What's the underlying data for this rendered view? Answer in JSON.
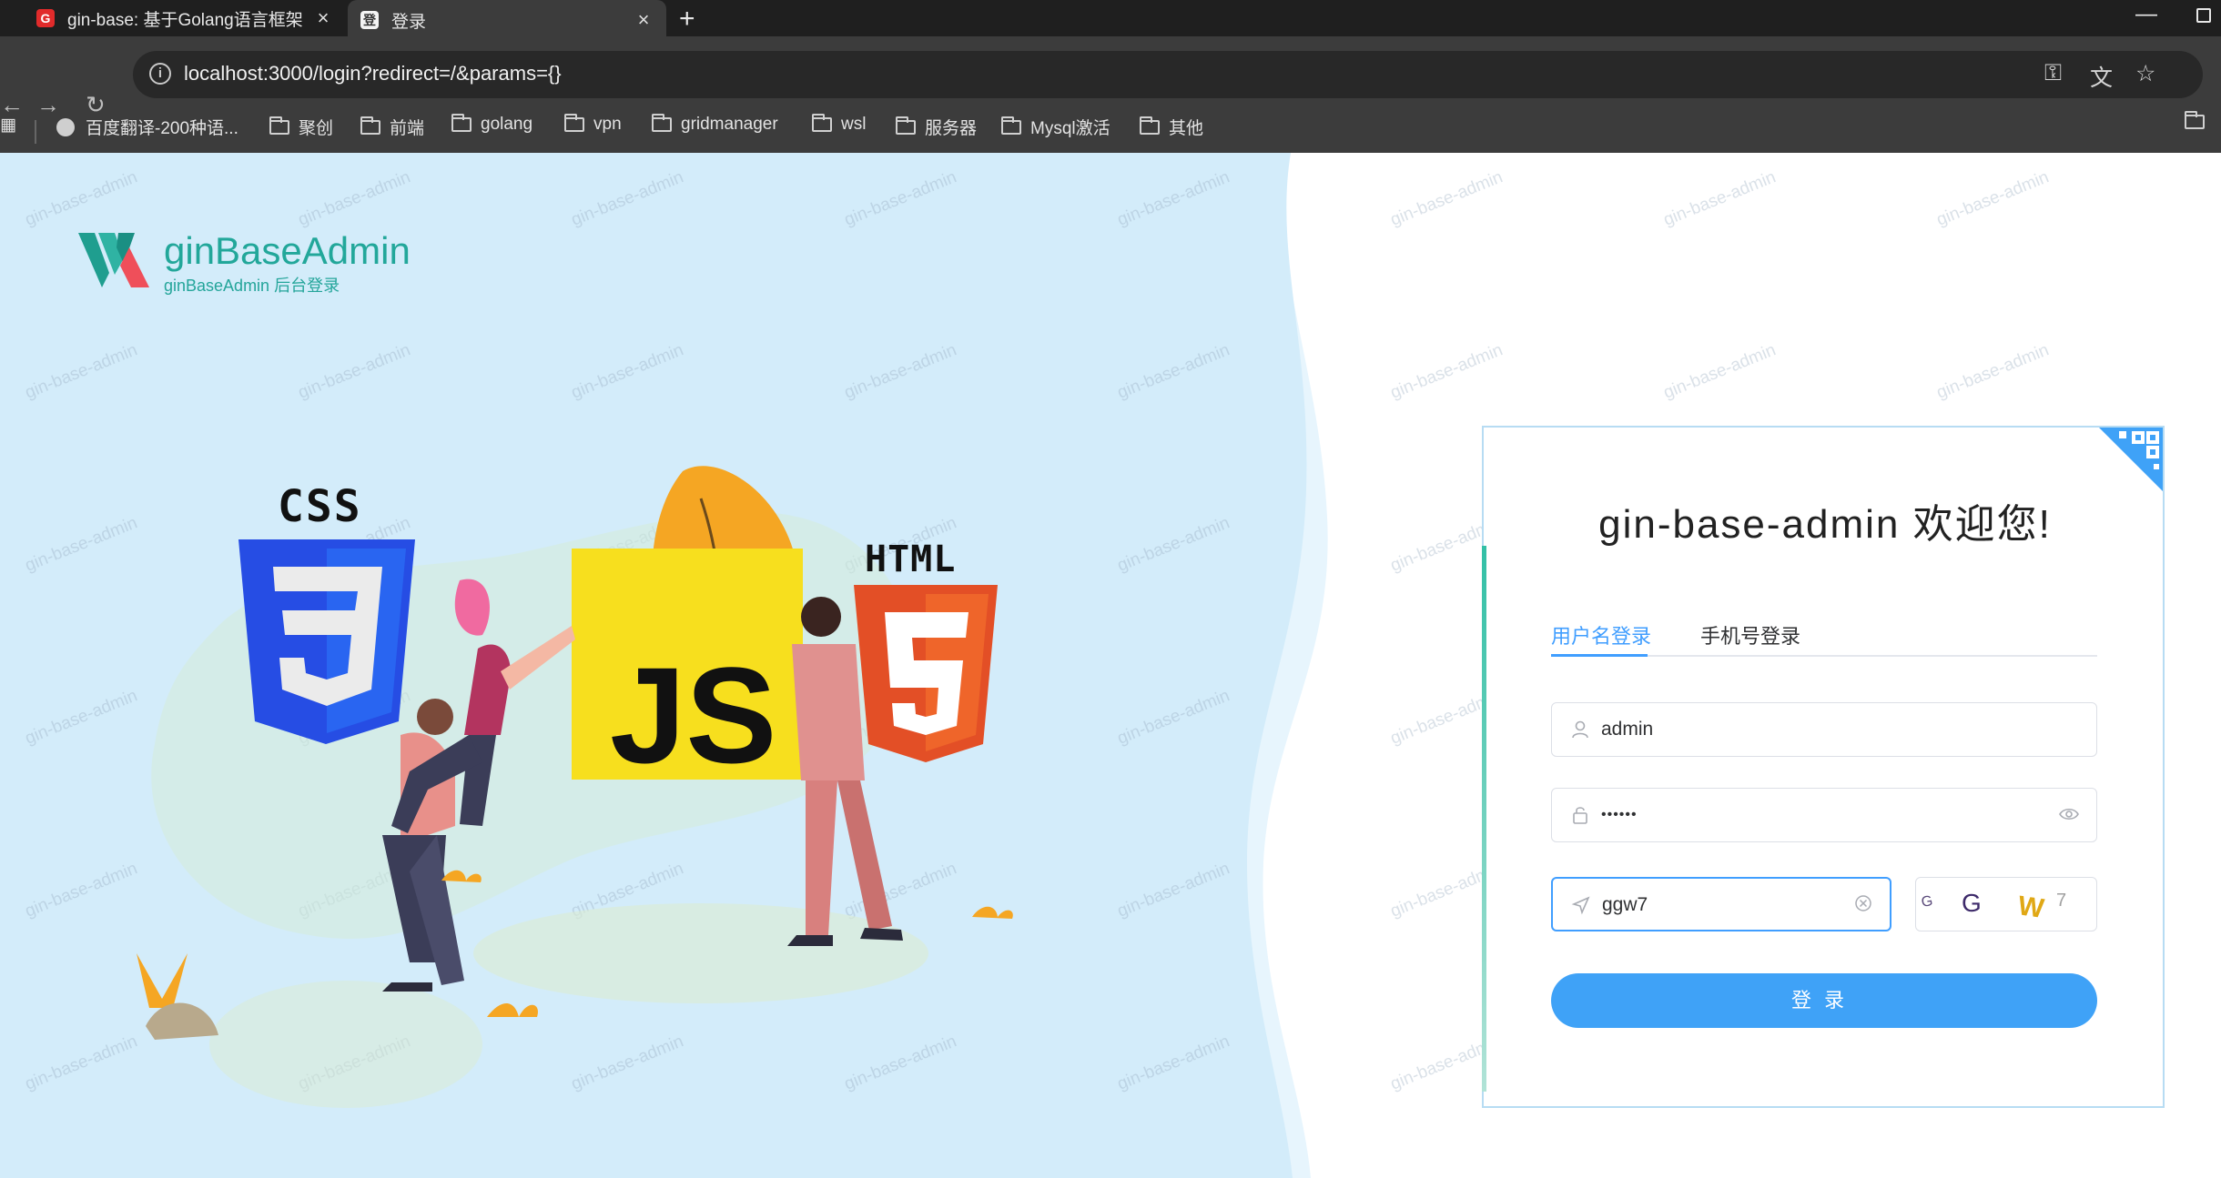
{
  "browser": {
    "tabs": [
      {
        "favicon": "G",
        "title": "gin-base: 基于Golang语言框架",
        "active": false
      },
      {
        "favicon": "登",
        "title": "登录",
        "active": true
      }
    ],
    "new_tab_symbol": "+",
    "minimize_symbol": "—",
    "url": "localhost:3000/login?redirect=/&params={}",
    "bookmarks": [
      {
        "icon": "globe-icon",
        "label": "百度翻译-200种语..."
      },
      {
        "icon": "folder-icon",
        "label": "聚创"
      },
      {
        "icon": "folder-icon",
        "label": "前端"
      },
      {
        "icon": "folder-icon",
        "label": "golang"
      },
      {
        "icon": "folder-icon",
        "label": "vpn"
      },
      {
        "icon": "folder-icon",
        "label": "gridmanager"
      },
      {
        "icon": "folder-icon",
        "label": "wsl"
      },
      {
        "icon": "folder-icon",
        "label": "服务器"
      },
      {
        "icon": "folder-icon",
        "label": "Mysql激活"
      },
      {
        "icon": "folder-icon",
        "label": "其他"
      }
    ]
  },
  "brand": {
    "name": "ginBaseAdmin",
    "subtitle": "ginBaseAdmin 后台登录"
  },
  "watermark_text": "gin-base-admin",
  "illustration": {
    "css_label": "CSS",
    "js_label": "JS",
    "html_label": "HTML"
  },
  "login": {
    "heading": "gin-base-admin 欢迎您!",
    "tabs": [
      "用户名登录",
      "手机号登录"
    ],
    "active_tab": 0,
    "username": {
      "value": "admin",
      "icon": "user-icon"
    },
    "password": {
      "value": "••••••",
      "icon": "lock-icon",
      "toggle_icon": "eye-icon"
    },
    "captcha_input": {
      "value": "ggw7",
      "icon": "send-icon",
      "clear_icon": "clear-circle-icon"
    },
    "captcha_image_chars": [
      "G",
      "G",
      "W",
      "7"
    ],
    "submit_label": "登录"
  },
  "colors": {
    "brand_teal": "#22a79a",
    "primary_blue": "#409eff",
    "button_blue": "#3fa2f7",
    "left_panel_bg": "#d3ecfa"
  }
}
